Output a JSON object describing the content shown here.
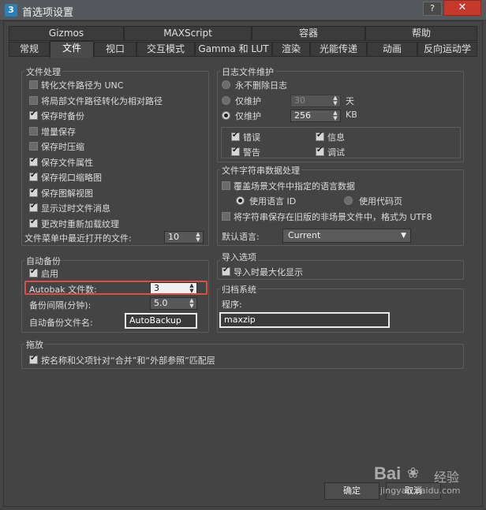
{
  "window": {
    "title": "首选项设置",
    "app_icon": "3",
    "help_label": "?",
    "close_label": "✕"
  },
  "tabs_row1": [
    "Gizmos",
    "MAXScript",
    "容器",
    "帮助"
  ],
  "tabs_row2": [
    "常规",
    "文件",
    "视口",
    "交互模式",
    "Gamma 和 LUT",
    "渲染",
    "光能传递",
    "动画",
    "反向运动学"
  ],
  "active_tab": "文件",
  "file_handling": {
    "title": "文件处理",
    "options": [
      {
        "label": "转化文件路径为 UNC",
        "checked": false
      },
      {
        "label": "将局部文件路径转化为相对路径",
        "checked": false
      },
      {
        "label": "保存时备份",
        "checked": true
      },
      {
        "label": "增量保存",
        "checked": false
      },
      {
        "label": "保存时压缩",
        "checked": false
      },
      {
        "label": "保存文件属性",
        "checked": true
      },
      {
        "label": "保存视口缩略图",
        "checked": true
      },
      {
        "label": "保存图解视图",
        "checked": true
      },
      {
        "label": "显示过时文件消息",
        "checked": true
      },
      {
        "label": "更改时重新加载纹理",
        "checked": true
      }
    ],
    "recent_label": "文件菜单中最近打开的文件:",
    "recent_value": "10"
  },
  "log_maintenance": {
    "title": "日志文件维护",
    "never_delete": "永不删除日志",
    "keep_label": "仅维护",
    "keep_days_value": "30",
    "days_unit": "天",
    "keep_kb_value": "256",
    "kb_unit": "KB",
    "levels": [
      {
        "label": "错误",
        "checked": true
      },
      {
        "label": "信息",
        "checked": true
      },
      {
        "label": "警告",
        "checked": true
      },
      {
        "label": "调试",
        "checked": true
      }
    ]
  },
  "string_data": {
    "title": "文件字符串数据处理",
    "override": "覆盖场景文件中指定的语言数据",
    "use_lang_id": "使用语言 ID",
    "use_codepage": "使用代码页",
    "save_utf8": "将字符串保存在旧版的非场景文件中，格式为 UTF8",
    "default_lang_label": "默认语言:",
    "default_lang_value": "Current"
  },
  "auto_backup": {
    "title": "自动备份",
    "enable": "启用",
    "count_label": "Autobak 文件数:",
    "count_value": "3",
    "interval_label": "备份间隔(分钟):",
    "interval_value": "5.0",
    "filename_label": "自动备份文件名:",
    "filename_value": "AutoBackup"
  },
  "import": {
    "title": "导入选项",
    "maximize": "导入时最大化显示"
  },
  "archive": {
    "title": "归档系统",
    "program_label": "程序:",
    "program_value": "maxzip"
  },
  "drag": {
    "title": "拖放",
    "match_layers": "按名称和父项针对“合并”和“外部参照”匹配层"
  },
  "buttons": {
    "ok": "确定",
    "cancel": "取消"
  },
  "watermark": {
    "logo": "Bai",
    "logo_cn": "经验",
    "url": "jingyan.baidu.com"
  },
  "colors": {
    "background": "#444444",
    "highlight": "#e14a4a",
    "close_button": "#c4392c"
  }
}
